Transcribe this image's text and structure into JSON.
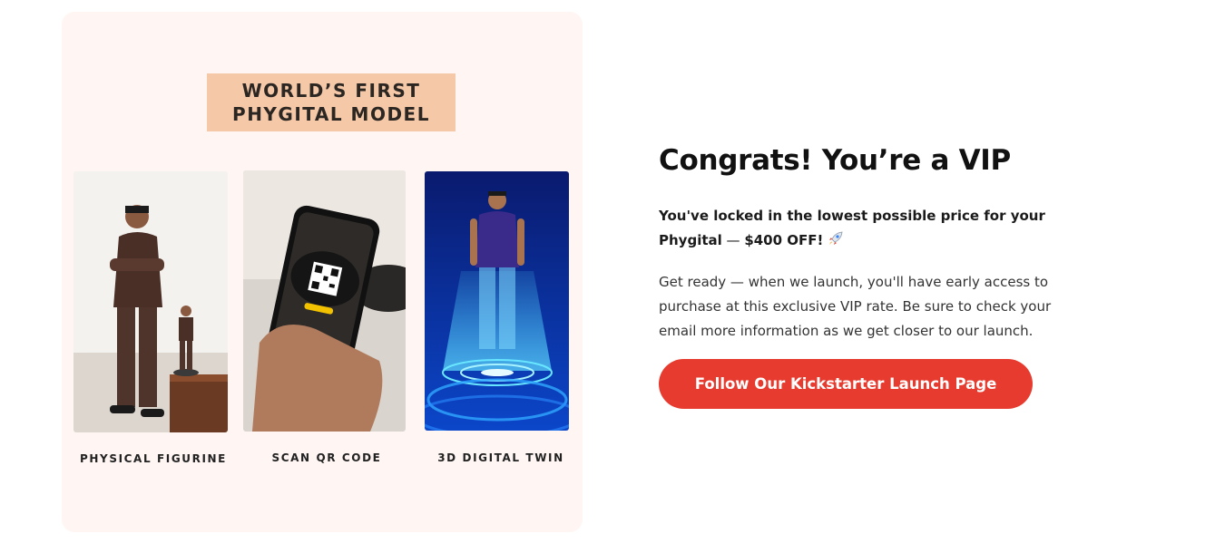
{
  "promo": {
    "title_line1": "WORLD’S FIRST",
    "title_line2": "PHYGITAL MODEL",
    "captions": [
      "PHYSICAL FIGURINE",
      "SCAN QR CODE",
      "3D DIGITAL TWIN"
    ]
  },
  "content": {
    "headline": "Congrats! You’re a VIP",
    "lead_part1": "You've locked in the lowest possible price for your Phygital",
    "lead_dash": " — ",
    "lead_part2": "$400 OFF!",
    "lead_icon": "rocket-icon",
    "body": "Get ready — when we launch, you'll have early access to purchase at this exclusive VIP rate. Be sure to check your email more information as we get closer to our launch.",
    "cta_label": "Follow Our Kickstarter Launch Page"
  },
  "colors": {
    "accent": "#e63b2e",
    "card_background": "#fff6f4",
    "title_badge": "#f5c8a8"
  }
}
